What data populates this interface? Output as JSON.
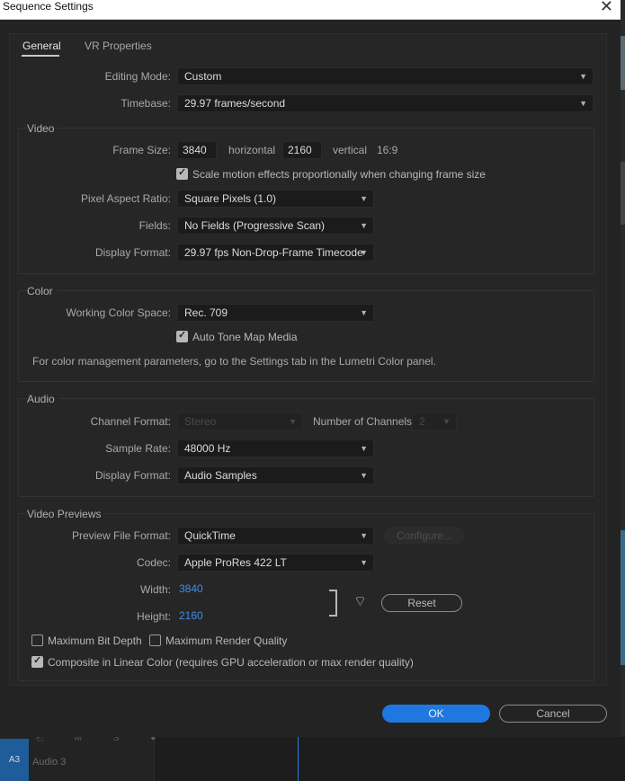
{
  "window": {
    "title": "Sequence Settings",
    "close_glyph": "✕"
  },
  "tabs": [
    {
      "label": "General",
      "active": true
    },
    {
      "label": "VR Properties",
      "active": false
    }
  ],
  "general": {
    "editing_mode_label": "Editing Mode:",
    "editing_mode_value": "Custom",
    "timebase_label": "Timebase:",
    "timebase_value": "29.97  frames/second"
  },
  "video": {
    "section": "Video",
    "frame_size_label": "Frame Size:",
    "width": "3840",
    "horizontal_label": "horizontal",
    "height": "2160",
    "vertical_label": "vertical",
    "aspect": "16:9",
    "scale_motion_label": "Scale motion effects proportionally when changing frame size",
    "scale_motion_checked": true,
    "par_label": "Pixel Aspect Ratio:",
    "par_value": "Square Pixels (1.0)",
    "fields_label": "Fields:",
    "fields_value": "No Fields (Progressive Scan)",
    "display_format_label": "Display Format:",
    "display_format_value": "29.97 fps Non-Drop-Frame Timecode"
  },
  "color": {
    "section": "Color",
    "working_space_label": "Working Color Space:",
    "working_space_value": "Rec. 709",
    "auto_tone_label": "Auto Tone Map Media",
    "auto_tone_checked": true,
    "note": "For color management parameters, go to the Settings tab in the Lumetri Color panel."
  },
  "audio": {
    "section": "Audio",
    "channel_format_label": "Channel Format:",
    "channel_format_value": "Stereo",
    "num_channels_label": "Number of Channels:",
    "num_channels_value": "2",
    "sample_rate_label": "Sample Rate:",
    "sample_rate_value": "48000 Hz",
    "display_format_label": "Display Format:",
    "display_format_value": "Audio Samples"
  },
  "previews": {
    "section": "Video Previews",
    "file_format_label": "Preview File Format:",
    "file_format_value": "QuickTime",
    "configure_label": "Configure...",
    "codec_label": "Codec:",
    "codec_value": "Apple ProRes 422 LT",
    "width_label": "Width:",
    "width_value": "3840",
    "height_label": "Height:",
    "height_value": "2160",
    "reset_label": "Reset",
    "max_bit_depth_label": "Maximum Bit Depth",
    "max_bit_depth_checked": false,
    "max_render_label": "Maximum Render Quality",
    "max_render_checked": false,
    "linear_color_label": "Composite in Linear Color (requires GPU acceleration or max render quality)",
    "linear_color_checked": true
  },
  "footer": {
    "ok_label": "OK",
    "cancel_label": "Cancel"
  },
  "background": {
    "track_id": "A3",
    "track_name": "Audio 3",
    "track_icons": "⎗ M S ●"
  },
  "colors": {
    "accent": "#1e78e0",
    "value_blue": "#3d8ee8",
    "panel": "#262626"
  },
  "icons": {
    "chevron": "chevron-down-icon",
    "link": "link-icon",
    "close": "close-icon"
  }
}
